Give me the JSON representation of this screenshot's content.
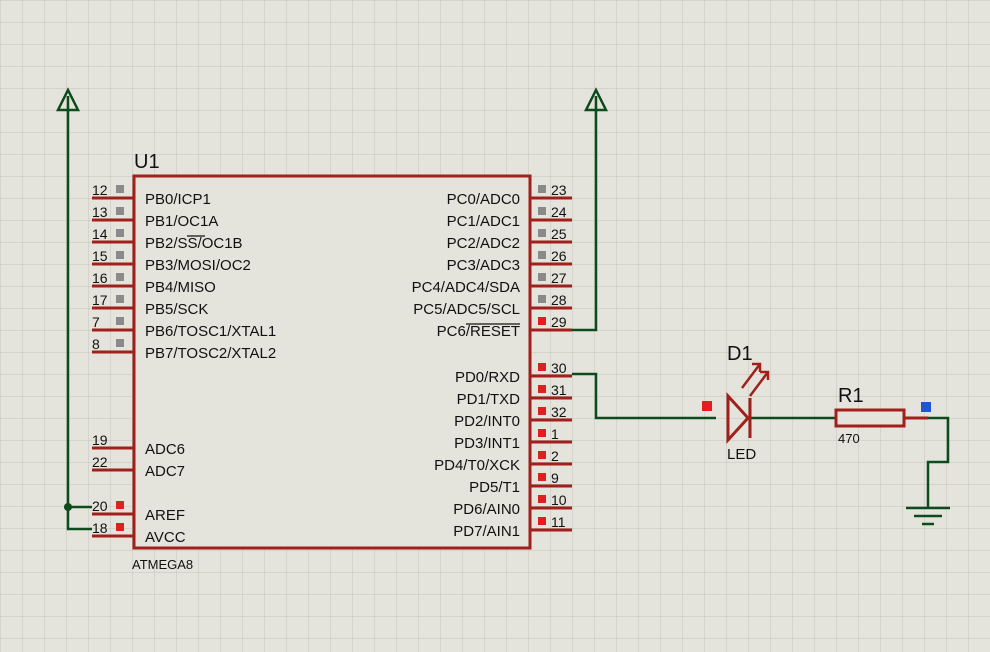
{
  "schematic": {
    "chip": {
      "ref": "U1",
      "part": "ATMEGA8",
      "left_pins": [
        {
          "num": "12",
          "name": "PB0/ICP1",
          "marker": "gray"
        },
        {
          "num": "13",
          "name": "PB1/OC1A",
          "marker": "gray"
        },
        {
          "num": "14",
          "name": "PB2/SS/OC1B",
          "marker": "gray"
        },
        {
          "num": "15",
          "name": "PB3/MOSI/OC2",
          "marker": "gray"
        },
        {
          "num": "16",
          "name": "PB4/MISO",
          "marker": "gray"
        },
        {
          "num": "17",
          "name": "PB5/SCK",
          "marker": "gray"
        },
        {
          "num": "7",
          "name": "PB6/TOSC1/XTAL1",
          "marker": "gray"
        },
        {
          "num": "8",
          "name": "PB7/TOSC2/XTAL2",
          "marker": "gray"
        },
        {
          "num": "19",
          "name": "ADC6",
          "marker": "none"
        },
        {
          "num": "22",
          "name": "ADC7",
          "marker": "none"
        },
        {
          "num": "20",
          "name": "AREF",
          "marker": "red"
        },
        {
          "num": "18",
          "name": "AVCC",
          "marker": "red"
        }
      ],
      "right_pins": [
        {
          "num": "23",
          "name": "PC0/ADC0",
          "marker": "gray"
        },
        {
          "num": "24",
          "name": "PC1/ADC1",
          "marker": "gray"
        },
        {
          "num": "25",
          "name": "PC2/ADC2",
          "marker": "gray"
        },
        {
          "num": "26",
          "name": "PC3/ADC3",
          "marker": "gray"
        },
        {
          "num": "27",
          "name": "PC4/ADC4/SDA",
          "marker": "gray"
        },
        {
          "num": "28",
          "name": "PC5/ADC5/SCL",
          "marker": "gray"
        },
        {
          "num": "29",
          "name": "PC6/RESET",
          "marker": "red"
        },
        {
          "num": "30",
          "name": "PD0/RXD",
          "marker": "red"
        },
        {
          "num": "31",
          "name": "PD1/TXD",
          "marker": "red"
        },
        {
          "num": "32",
          "name": "PD2/INT0",
          "marker": "red"
        },
        {
          "num": "1",
          "name": "PD3/INT1",
          "marker": "red"
        },
        {
          "num": "2",
          "name": "PD4/T0/XCK",
          "marker": "red"
        },
        {
          "num": "9",
          "name": "PD5/T1",
          "marker": "red"
        },
        {
          "num": "10",
          "name": "PD6/AIN0",
          "marker": "red"
        },
        {
          "num": "11",
          "name": "PD7/AIN1",
          "marker": "red"
        }
      ]
    },
    "led": {
      "ref": "D1",
      "value": "LED"
    },
    "resistor": {
      "ref": "R1",
      "value": "470"
    },
    "colors": {
      "background": "#e4e4dc",
      "grid": "#c4c4bc",
      "component": "#a0201c",
      "wire": "#0d4a1c",
      "marker_gray": "#8a8a8a",
      "marker_red": "#e02020",
      "marker_blue": "#1e56d8"
    }
  }
}
